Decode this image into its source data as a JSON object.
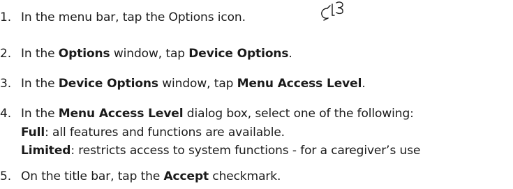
{
  "steps": [
    {
      "num": "1.",
      "text1": "In the menu bar, tap the Options icon."
    },
    {
      "num": "2.",
      "text1": "In the ",
      "bold1": "Options",
      "text2": " window, tap ",
      "bold2": "Device Options",
      "text3": "."
    },
    {
      "num": "3.",
      "text1": "In the ",
      "bold1": "Device Options",
      "text2": " window, tap ",
      "bold2": "Menu Access Level",
      "text3": "."
    },
    {
      "num": "4.",
      "text1": "In the ",
      "bold1": "Menu Access Level",
      "text2": " dialog box, select one of the following:",
      "sub": [
        {
          "bold": "Full",
          "text": ": all features and functions are available."
        },
        {
          "bold": "Limited",
          "text": ": restricts access to system functions - for a caregiver’s use"
        }
      ]
    },
    {
      "num": "5.",
      "text1": "On the title bar, tap the ",
      "bold1": "Accept",
      "text2": " checkmark."
    }
  ],
  "icons": {
    "options": "options-wrench-icon"
  }
}
